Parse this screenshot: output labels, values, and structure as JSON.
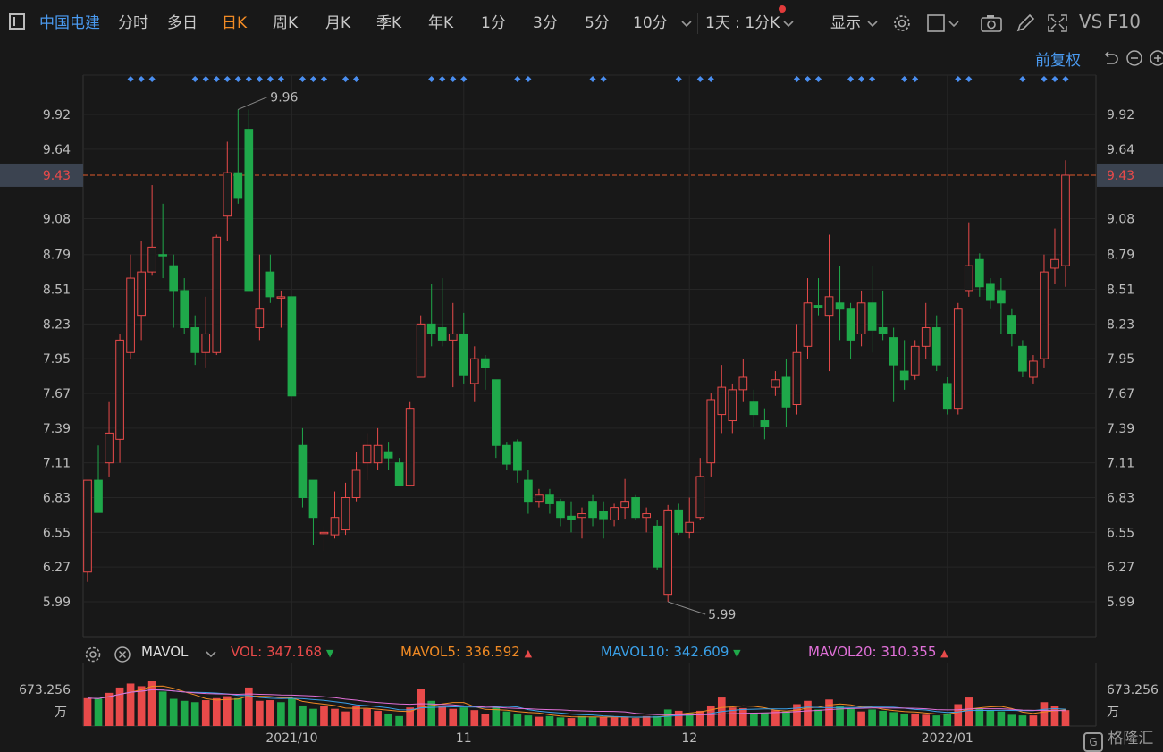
{
  "toolbar": {
    "stock_name": "中国电建",
    "periods": [
      "分时",
      "多日",
      "日K",
      "周K",
      "月K",
      "季K",
      "年K",
      "1分",
      "3分",
      "5分",
      "10分"
    ],
    "active_period": "日K",
    "range_select": "1天 : 1分K",
    "display_label": "显示",
    "vs_label": "VS",
    "f10_label": "F10",
    "adjust_label": "前复权"
  },
  "colors": {
    "up": "#e84a4a",
    "down": "#1fa84a",
    "accent": "#3a8fe0",
    "active": "#f08a24",
    "price_line": "#e05a2b",
    "marker": "#4a8ef0"
  },
  "icons": [
    "chart-toggle-icon",
    "chevron-down-icon",
    "settings-icon",
    "square-icon",
    "camera-icon",
    "pen-icon",
    "fullscreen-icon",
    "undo-icon",
    "zoom-out-icon",
    "zoom-in-icon",
    "close-circle-icon"
  ],
  "chart_data": {
    "type": "candlestick",
    "yticks": [
      "9.92",
      "9.64",
      "9.43",
      "9.08",
      "8.79",
      "8.51",
      "8.23",
      "7.95",
      "7.67",
      "7.39",
      "7.11",
      "6.83",
      "6.55",
      "6.27",
      "5.99"
    ],
    "ylim": [
      5.85,
      10.1
    ],
    "current_price": "9.43",
    "xticks": [
      {
        "label": "2021/10",
        "index": 19
      },
      {
        "label": "11",
        "index": 35
      },
      {
        "label": "12",
        "index": 56
      },
      {
        "label": "2022/01",
        "index": 80
      }
    ],
    "high_label": "9.96",
    "low_label": "5.99",
    "marker_indices": [
      4,
      5,
      6,
      10,
      11,
      12,
      13,
      14,
      15,
      16,
      17,
      18,
      20,
      21,
      22,
      24,
      25,
      32,
      33,
      34,
      35,
      40,
      41,
      47,
      48,
      55,
      57,
      58,
      66,
      67,
      68,
      71,
      72,
      73,
      76,
      77,
      81,
      82,
      87,
      89,
      90,
      91
    ],
    "candles": [
      {
        "o": 6.23,
        "c": 6.97,
        "h": 6.97,
        "l": 6.15
      },
      {
        "o": 6.97,
        "c": 6.71,
        "h": 7.25,
        "l": 6.87
      },
      {
        "o": 7.11,
        "c": 7.35,
        "h": 7.6,
        "l": 7.0
      },
      {
        "o": 7.3,
        "c": 8.1,
        "h": 8.15,
        "l": 7.11
      },
      {
        "o": 8.0,
        "c": 8.6,
        "h": 8.79,
        "l": 7.95
      },
      {
        "o": 8.3,
        "c": 8.65,
        "h": 8.9,
        "l": 8.1
      },
      {
        "o": 8.65,
        "c": 8.85,
        "h": 9.35,
        "l": 8.62
      },
      {
        "o": 8.79,
        "c": 8.78,
        "h": 9.2,
        "l": 8.6
      },
      {
        "o": 8.7,
        "c": 8.5,
        "h": 8.79,
        "l": 8.2
      },
      {
        "o": 8.5,
        "c": 8.2,
        "h": 8.6,
        "l": 8.15
      },
      {
        "o": 8.2,
        "c": 8.0,
        "h": 8.3,
        "l": 7.9
      },
      {
        "o": 8.0,
        "c": 8.15,
        "h": 8.45,
        "l": 7.88
      },
      {
        "o": 8.0,
        "c": 8.93,
        "h": 8.95,
        "l": 7.98
      },
      {
        "o": 9.1,
        "c": 9.45,
        "h": 9.7,
        "l": 8.9
      },
      {
        "o": 9.45,
        "c": 9.25,
        "h": 9.96,
        "l": 9.2
      },
      {
        "o": 9.8,
        "c": 8.5,
        "h": 9.96,
        "l": 8.5
      },
      {
        "o": 8.2,
        "c": 8.35,
        "h": 8.79,
        "l": 8.1
      },
      {
        "o": 8.65,
        "c": 8.45,
        "h": 8.79,
        "l": 8.4
      },
      {
        "o": 8.45,
        "c": 8.45,
        "h": 8.5,
        "l": 8.2
      },
      {
        "o": 8.45,
        "c": 7.65,
        "h": 8.45,
        "l": 7.65
      },
      {
        "o": 7.25,
        "c": 6.83,
        "h": 7.39,
        "l": 6.75
      },
      {
        "o": 6.97,
        "c": 6.67,
        "h": 6.97,
        "l": 6.45
      },
      {
        "o": 6.55,
        "c": 6.55,
        "h": 6.6,
        "l": 6.4
      },
      {
        "o": 6.53,
        "c": 6.67,
        "h": 6.88,
        "l": 6.5
      },
      {
        "o": 6.57,
        "c": 6.83,
        "h": 6.95,
        "l": 6.53
      },
      {
        "o": 6.83,
        "c": 7.05,
        "h": 7.2,
        "l": 6.8
      },
      {
        "o": 7.11,
        "c": 7.25,
        "h": 7.35,
        "l": 6.97
      },
      {
        "o": 7.11,
        "c": 7.25,
        "h": 7.39,
        "l": 7.05
      },
      {
        "o": 7.2,
        "c": 7.15,
        "h": 7.28,
        "l": 7.05
      },
      {
        "o": 7.11,
        "c": 6.93,
        "h": 7.15,
        "l": 6.92
      },
      {
        "o": 6.93,
        "c": 7.55,
        "h": 7.6,
        "l": 6.93
      },
      {
        "o": 7.8,
        "c": 8.23,
        "h": 8.3,
        "l": 7.8
      },
      {
        "o": 8.23,
        "c": 8.15,
        "h": 8.55,
        "l": 8.05
      },
      {
        "o": 8.2,
        "c": 8.1,
        "h": 8.6,
        "l": 8.05
      },
      {
        "o": 8.1,
        "c": 8.15,
        "h": 8.4,
        "l": 7.72
      },
      {
        "o": 8.15,
        "c": 7.82,
        "h": 8.32,
        "l": 7.75
      },
      {
        "o": 7.75,
        "c": 7.95,
        "h": 8.05,
        "l": 7.6
      },
      {
        "o": 7.95,
        "c": 7.88,
        "h": 7.98,
        "l": 7.7
      },
      {
        "o": 7.78,
        "c": 7.25,
        "h": 7.78,
        "l": 7.15
      },
      {
        "o": 7.25,
        "c": 7.1,
        "h": 7.28,
        "l": 7.05
      },
      {
        "o": 7.28,
        "c": 7.05,
        "h": 7.3,
        "l": 6.95
      },
      {
        "o": 6.97,
        "c": 6.8,
        "h": 7.05,
        "l": 6.7
      },
      {
        "o": 6.8,
        "c": 6.85,
        "h": 6.9,
        "l": 6.75
      },
      {
        "o": 6.85,
        "c": 6.78,
        "h": 6.9,
        "l": 6.7
      },
      {
        "o": 6.8,
        "c": 6.67,
        "h": 6.82,
        "l": 6.6
      },
      {
        "o": 6.68,
        "c": 6.65,
        "h": 6.8,
        "l": 6.55
      },
      {
        "o": 6.67,
        "c": 6.7,
        "h": 6.75,
        "l": 6.5
      },
      {
        "o": 6.8,
        "c": 6.67,
        "h": 6.85,
        "l": 6.6
      },
      {
        "o": 6.72,
        "c": 6.66,
        "h": 6.8,
        "l": 6.5
      },
      {
        "o": 6.65,
        "c": 6.75,
        "h": 6.78,
        "l": 6.6
      },
      {
        "o": 6.75,
        "c": 6.8,
        "h": 6.98,
        "l": 6.66
      },
      {
        "o": 6.83,
        "c": 6.67,
        "h": 6.85,
        "l": 6.65
      },
      {
        "o": 6.67,
        "c": 6.7,
        "h": 6.75,
        "l": 6.55
      },
      {
        "o": 6.6,
        "c": 6.27,
        "h": 6.65,
        "l": 6.25
      },
      {
        "o": 6.05,
        "c": 6.73,
        "h": 6.77,
        "l": 5.99
      },
      {
        "o": 6.73,
        "c": 6.55,
        "h": 6.78,
        "l": 6.53
      },
      {
        "o": 6.55,
        "c": 6.63,
        "h": 6.83,
        "l": 6.5
      },
      {
        "o": 6.67,
        "c": 7.0,
        "h": 7.15,
        "l": 6.65
      },
      {
        "o": 7.11,
        "c": 7.62,
        "h": 7.67,
        "l": 7.0
      },
      {
        "o": 7.5,
        "c": 7.72,
        "h": 7.9,
        "l": 7.35
      },
      {
        "o": 7.45,
        "c": 7.7,
        "h": 7.75,
        "l": 7.35
      },
      {
        "o": 7.7,
        "c": 7.8,
        "h": 7.95,
        "l": 7.6
      },
      {
        "o": 7.6,
        "c": 7.5,
        "h": 7.7,
        "l": 7.4
      },
      {
        "o": 7.45,
        "c": 7.4,
        "h": 7.55,
        "l": 7.3
      },
      {
        "o": 7.72,
        "c": 7.78,
        "h": 7.85,
        "l": 7.65
      },
      {
        "o": 7.8,
        "c": 7.56,
        "h": 7.95,
        "l": 7.4
      },
      {
        "o": 7.58,
        "c": 8.0,
        "h": 8.23,
        "l": 7.5
      },
      {
        "o": 8.05,
        "c": 8.4,
        "h": 8.6,
        "l": 7.95
      },
      {
        "o": 8.38,
        "c": 8.36,
        "h": 8.6,
        "l": 8.3
      },
      {
        "o": 8.3,
        "c": 8.45,
        "h": 8.95,
        "l": 7.85
      },
      {
        "o": 8.4,
        "c": 8.35,
        "h": 8.7,
        "l": 8.1
      },
      {
        "o": 8.35,
        "c": 8.1,
        "h": 8.4,
        "l": 7.95
      },
      {
        "o": 8.15,
        "c": 8.4,
        "h": 8.5,
        "l": 8.05
      },
      {
        "o": 8.4,
        "c": 8.18,
        "h": 8.7,
        "l": 8.0
      },
      {
        "o": 8.2,
        "c": 8.15,
        "h": 8.5,
        "l": 8.1
      },
      {
        "o": 8.12,
        "c": 7.9,
        "h": 8.2,
        "l": 7.6
      },
      {
        "o": 7.85,
        "c": 7.78,
        "h": 8.1,
        "l": 7.7
      },
      {
        "o": 7.82,
        "c": 8.05,
        "h": 8.1,
        "l": 7.78
      },
      {
        "o": 8.05,
        "c": 8.2,
        "h": 8.4,
        "l": 7.95
      },
      {
        "o": 8.2,
        "c": 7.9,
        "h": 8.3,
        "l": 7.85
      },
      {
        "o": 7.75,
        "c": 7.55,
        "h": 7.8,
        "l": 7.5
      },
      {
        "o": 7.55,
        "c": 8.35,
        "h": 8.4,
        "l": 7.5
      },
      {
        "o": 8.5,
        "c": 8.7,
        "h": 9.05,
        "l": 8.45
      },
      {
        "o": 8.75,
        "c": 8.53,
        "h": 8.8,
        "l": 8.45
      },
      {
        "o": 8.55,
        "c": 8.42,
        "h": 8.6,
        "l": 8.35
      },
      {
        "o": 8.5,
        "c": 8.4,
        "h": 8.6,
        "l": 8.15
      },
      {
        "o": 8.3,
        "c": 8.15,
        "h": 8.35,
        "l": 8.05
      },
      {
        "o": 8.05,
        "c": 7.85,
        "h": 8.1,
        "l": 7.8
      },
      {
        "o": 7.8,
        "c": 7.93,
        "h": 7.98,
        "l": 7.75
      },
      {
        "o": 7.95,
        "c": 8.65,
        "h": 8.79,
        "l": 7.88
      },
      {
        "o": 8.68,
        "c": 8.75,
        "h": 9.0,
        "l": 8.55
      },
      {
        "o": 8.7,
        "c": 9.43,
        "h": 9.55,
        "l": 8.53
      }
    ],
    "volume": [
      {
        "v": 420,
        "up": true
      },
      {
        "v": 410,
        "up": false
      },
      {
        "v": 500,
        "up": true
      },
      {
        "v": 580,
        "up": true
      },
      {
        "v": 640,
        "up": true
      },
      {
        "v": 600,
        "up": true
      },
      {
        "v": 673,
        "up": true
      },
      {
        "v": 520,
        "up": false
      },
      {
        "v": 410,
        "up": false
      },
      {
        "v": 380,
        "up": false
      },
      {
        "v": 360,
        "up": false
      },
      {
        "v": 390,
        "up": true
      },
      {
        "v": 420,
        "up": true
      },
      {
        "v": 450,
        "up": true
      },
      {
        "v": 420,
        "up": false
      },
      {
        "v": 580,
        "up": true
      },
      {
        "v": 380,
        "up": true
      },
      {
        "v": 390,
        "up": true
      },
      {
        "v": 360,
        "up": false
      },
      {
        "v": 420,
        "up": false
      },
      {
        "v": 310,
        "up": false
      },
      {
        "v": 260,
        "up": false
      },
      {
        "v": 300,
        "up": true
      },
      {
        "v": 260,
        "up": true
      },
      {
        "v": 220,
        "up": true
      },
      {
        "v": 300,
        "up": true
      },
      {
        "v": 260,
        "up": true
      },
      {
        "v": 230,
        "up": true
      },
      {
        "v": 180,
        "up": false
      },
      {
        "v": 150,
        "up": false
      },
      {
        "v": 280,
        "up": true
      },
      {
        "v": 560,
        "up": true
      },
      {
        "v": 380,
        "up": false
      },
      {
        "v": 300,
        "up": true
      },
      {
        "v": 260,
        "up": true
      },
      {
        "v": 280,
        "up": false
      },
      {
        "v": 240,
        "up": true
      },
      {
        "v": 180,
        "up": true
      },
      {
        "v": 280,
        "up": false
      },
      {
        "v": 220,
        "up": false
      },
      {
        "v": 180,
        "up": false
      },
      {
        "v": 160,
        "up": false
      },
      {
        "v": 140,
        "up": true
      },
      {
        "v": 150,
        "up": false
      },
      {
        "v": 130,
        "up": false
      },
      {
        "v": 120,
        "up": true
      },
      {
        "v": 150,
        "up": false
      },
      {
        "v": 140,
        "up": false
      },
      {
        "v": 140,
        "up": true
      },
      {
        "v": 130,
        "up": true
      },
      {
        "v": 130,
        "up": true
      },
      {
        "v": 120,
        "up": true
      },
      {
        "v": 150,
        "up": true
      },
      {
        "v": 150,
        "up": false
      },
      {
        "v": 250,
        "up": false
      },
      {
        "v": 230,
        "up": true
      },
      {
        "v": 200,
        "up": false
      },
      {
        "v": 230,
        "up": true
      },
      {
        "v": 310,
        "up": true
      },
      {
        "v": 430,
        "up": true
      },
      {
        "v": 280,
        "up": true
      },
      {
        "v": 270,
        "up": true
      },
      {
        "v": 200,
        "up": false
      },
      {
        "v": 200,
        "up": false
      },
      {
        "v": 240,
        "up": true
      },
      {
        "v": 220,
        "up": false
      },
      {
        "v": 330,
        "up": true
      },
      {
        "v": 380,
        "up": true
      },
      {
        "v": 250,
        "up": false
      },
      {
        "v": 400,
        "up": true
      },
      {
        "v": 310,
        "up": false
      },
      {
        "v": 260,
        "up": false
      },
      {
        "v": 220,
        "up": true
      },
      {
        "v": 250,
        "up": false
      },
      {
        "v": 230,
        "up": false
      },
      {
        "v": 210,
        "up": false
      },
      {
        "v": 180,
        "up": false
      },
      {
        "v": 190,
        "up": true
      },
      {
        "v": 170,
        "up": true
      },
      {
        "v": 160,
        "up": false
      },
      {
        "v": 190,
        "up": false
      },
      {
        "v": 330,
        "up": true
      },
      {
        "v": 430,
        "up": true
      },
      {
        "v": 260,
        "up": false
      },
      {
        "v": 240,
        "up": false
      },
      {
        "v": 220,
        "up": false
      },
      {
        "v": 170,
        "up": false
      },
      {
        "v": 160,
        "up": false
      },
      {
        "v": 160,
        "up": true
      },
      {
        "v": 360,
        "up": true
      },
      {
        "v": 300,
        "up": true
      },
      {
        "v": 240,
        "up": true
      }
    ],
    "volume_max_label": "673.256",
    "volume_unit": "万",
    "indicators": {
      "name": "MAVOL",
      "vol_label": "VOL:",
      "vol_value": "347.168",
      "vol_dir": "down",
      "ma5_label": "MAVOL5:",
      "ma5_value": "336.592",
      "ma5_dir": "up",
      "ma10_label": "MAVOL10:",
      "ma10_value": "342.609",
      "ma10_dir": "down",
      "ma20_label": "MAVOL20:",
      "ma20_value": "310.355",
      "ma20_dir": "up"
    }
  },
  "brand": "格隆汇"
}
